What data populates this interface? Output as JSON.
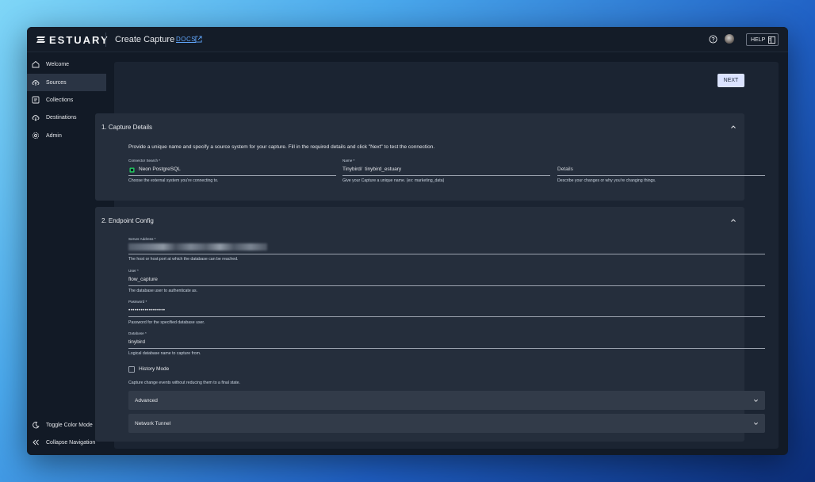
{
  "app": {
    "brand": "ESTUARY",
    "page_title": "Create Capture",
    "docs_link": "DOCS",
    "help_label": "HELP"
  },
  "sidebar": {
    "items": [
      {
        "label": "Welcome",
        "icon": "home-icon",
        "active": false
      },
      {
        "label": "Sources",
        "icon": "cloud-upload-icon",
        "active": true
      },
      {
        "label": "Collections",
        "icon": "collection-icon",
        "active": false
      },
      {
        "label": "Destinations",
        "icon": "cloud-download-icon",
        "active": false
      },
      {
        "label": "Admin",
        "icon": "gear-icon",
        "active": false
      }
    ],
    "bottom": [
      {
        "label": "Toggle Color Mode",
        "icon": "moon-icon"
      },
      {
        "label": "Collapse Navigation",
        "icon": "double-chevron-left-icon"
      }
    ]
  },
  "toolbar": {
    "next_label": "NEXT"
  },
  "capture_details": {
    "title": "1. Capture Details",
    "description": "Provide a unique name and specify a source system for your capture. Fill in the required details and click \"Next\" to test the connection.",
    "connector": {
      "label": "Connector Search *",
      "value": "Neon PostgreSQL",
      "help": "Choose the external system you're connecting to."
    },
    "name": {
      "label": "Name *",
      "value": "Tinybird/  tinybird_estuary",
      "help": "Give your Capture a unique name. (ex: marketing_data)"
    },
    "details": {
      "placeholder": "Details",
      "help": "Describe your changes or why you're changing things."
    }
  },
  "endpoint_config": {
    "title": "2. Endpoint Config",
    "server_address": {
      "label": "Server Address *",
      "help": "The host or host:port at which the database can be reached."
    },
    "user": {
      "label": "User *",
      "value": "flow_capture",
      "help": "The database user to authenticate as."
    },
    "password": {
      "label": "Password *",
      "value": "••••••••••••••••••",
      "help": "Password for the specified database user."
    },
    "database": {
      "label": "Database *",
      "value": "tinybird",
      "help": "Logical database name to capture from."
    },
    "history_mode": {
      "label": "History Mode",
      "checked": false,
      "help": "Capture change events without reducing them to a final state."
    },
    "advanced_label": "Advanced",
    "network_tunnel_label": "Network Tunnel"
  },
  "colors": {
    "accent_button": "#dbe3ff",
    "link": "#60a5fa",
    "connector_icon": "#22c55e"
  }
}
